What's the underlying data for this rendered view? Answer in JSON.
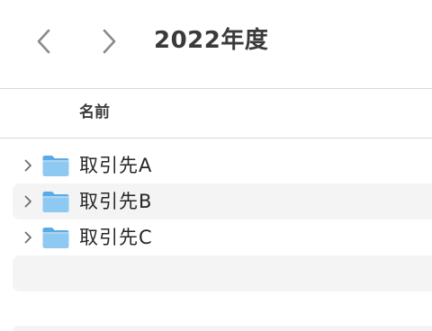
{
  "window": {
    "title": "2022年度"
  },
  "toolbar": {
    "back_icon": "chevron-left-icon",
    "forward_icon": "chevron-right-icon"
  },
  "columns": {
    "name_label": "名前"
  },
  "items": [
    {
      "label": "取引先A",
      "icon": "folder-icon",
      "expanded": false
    },
    {
      "label": "取引先B",
      "icon": "folder-icon",
      "expanded": false
    },
    {
      "label": "取引先C",
      "icon": "folder-icon",
      "expanded": false
    }
  ],
  "colors": {
    "folder_light": "#8ec9f2",
    "folder_dark": "#5aaae6",
    "row_alt": "#f4f4f4",
    "divider": "#d9d9d9"
  }
}
